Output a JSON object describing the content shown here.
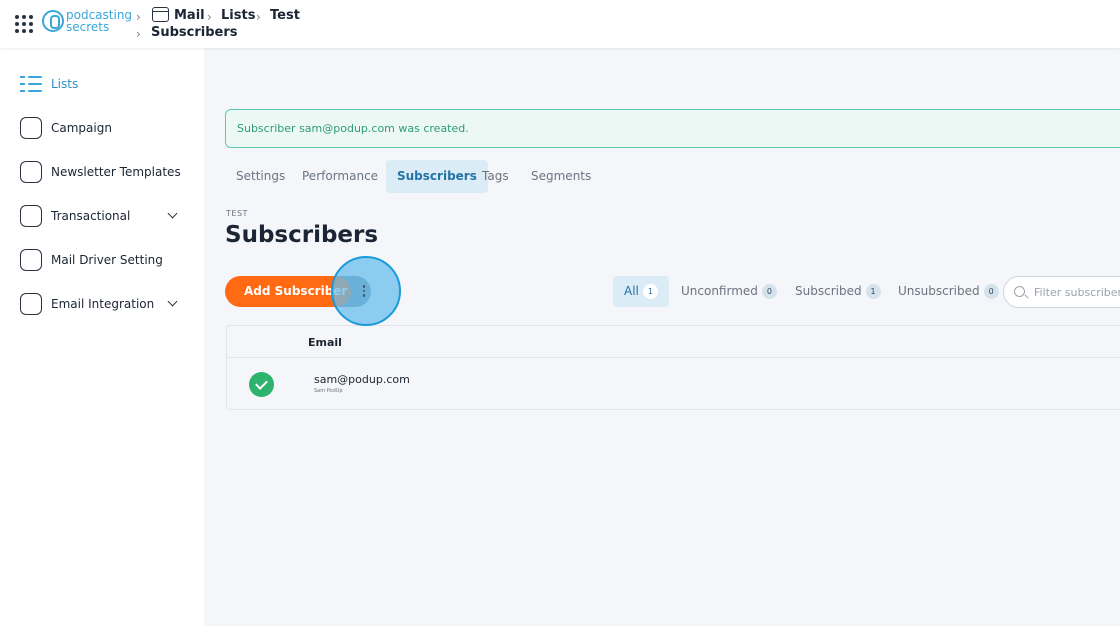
{
  "topbar": {
    "logo_line1": "podcasting",
    "logo_line2": "secrets",
    "breadcrumb": [
      "Mail",
      "Lists",
      "Test",
      "Subscribers"
    ]
  },
  "sidebar": {
    "items": [
      {
        "label": "Lists",
        "icon": "list-icon",
        "active": true
      },
      {
        "label": "Campaign",
        "icon": "megaphone-icon"
      },
      {
        "label": "Newsletter Templates",
        "icon": "newsletter-icon"
      },
      {
        "label": "Transactional",
        "icon": "inbox-icon",
        "expandable": true
      },
      {
        "label": "Mail Driver Setting",
        "icon": "mail-driver-icon"
      },
      {
        "label": "Email Integration",
        "icon": "integration-icon",
        "expandable": true
      }
    ]
  },
  "alert": {
    "text": "Subscriber sam@podup.com was created."
  },
  "tabs": [
    "Settings",
    "Performance",
    "Subscribers",
    "Tags",
    "Segments"
  ],
  "active_tab": "Subscribers",
  "list_caption": "TEST",
  "page_title": "Subscribers",
  "add_button": "Add Subscriber",
  "filters": [
    {
      "label": "All",
      "count": "1"
    },
    {
      "label": "Unconfirmed",
      "count": "0"
    },
    {
      "label": "Subscribed",
      "count": "1"
    },
    {
      "label": "Unsubscribed",
      "count": "0"
    }
  ],
  "search": {
    "placeholder": "Filter subscribers"
  },
  "table": {
    "headers": [
      "Email"
    ],
    "rows": [
      {
        "email": "sam@podup.com",
        "name": "Sam PodUp",
        "status": "subscribed"
      }
    ]
  },
  "colors": {
    "accent": "#ff6a13",
    "primary": "#2f8fc2",
    "success": "#2eb36e"
  }
}
